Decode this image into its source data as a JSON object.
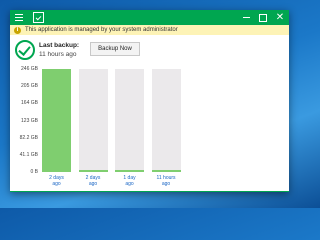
{
  "title_bar": {
    "menu_icon": "hamburger-icon",
    "logo_icon": "veeam-logo-icon",
    "controls": {
      "minimize": "minimize-icon",
      "maximize": "maximize-icon",
      "close": "close-icon",
      "close_glyph": "✕"
    },
    "accent_color": "#00a650"
  },
  "info_bar": {
    "icon_glyph": "i",
    "message": "This application is managed by your system administrator",
    "background": "#fdf3b6"
  },
  "status": {
    "icon": "success-check-icon",
    "last_backup_label": "Last backup:",
    "last_backup_time": "11 hours ago",
    "backup_button_label": "Backup Now"
  },
  "chart_data": {
    "type": "bar",
    "y_tick_labels": [
      "246 GB",
      "205 GB",
      "164 GB",
      "123 GB",
      "82.2 GB",
      "41.1 GB",
      "0 B"
    ],
    "ylim_gb": [
      0,
      246
    ],
    "categories": [
      [
        "2 days",
        "ago"
      ],
      [
        "2 days",
        "ago"
      ],
      [
        "1 day",
        "ago"
      ],
      [
        "11 hours",
        "ago"
      ]
    ],
    "values_gb": [
      246,
      3.5,
      3.5,
      3.5
    ],
    "bar_color": "#7fce6f",
    "track_color": "#ebe9eb"
  }
}
